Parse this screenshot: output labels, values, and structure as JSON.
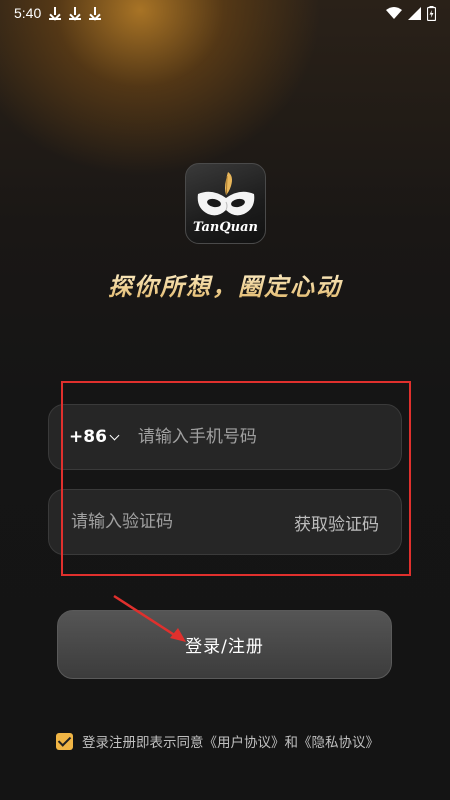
{
  "status_bar": {
    "time": "5:40",
    "icons": [
      "download-icon",
      "download-icon",
      "download-icon",
      "wifi-icon",
      "signal-icon",
      "battery-icon"
    ]
  },
  "logo": {
    "text": "TanQuan",
    "icon": "mask-icon"
  },
  "slogan": "探你所想，圈定心动",
  "login_form": {
    "country_code": "+86",
    "phone_placeholder": "请输入手机号码",
    "code_placeholder": "请输入验证码",
    "get_code_label": "获取验证码"
  },
  "login_button": {
    "label": "登录/注册"
  },
  "agreement": {
    "checked": true,
    "prefix": "登录注册即表示同意",
    "user_agreement": "《用户协议》",
    "and": "和",
    "privacy_policy": "《隐私协议》"
  },
  "colors": {
    "accent_gold": "#f0b545",
    "annotation_red": "#e0302d",
    "background": "#141414"
  }
}
